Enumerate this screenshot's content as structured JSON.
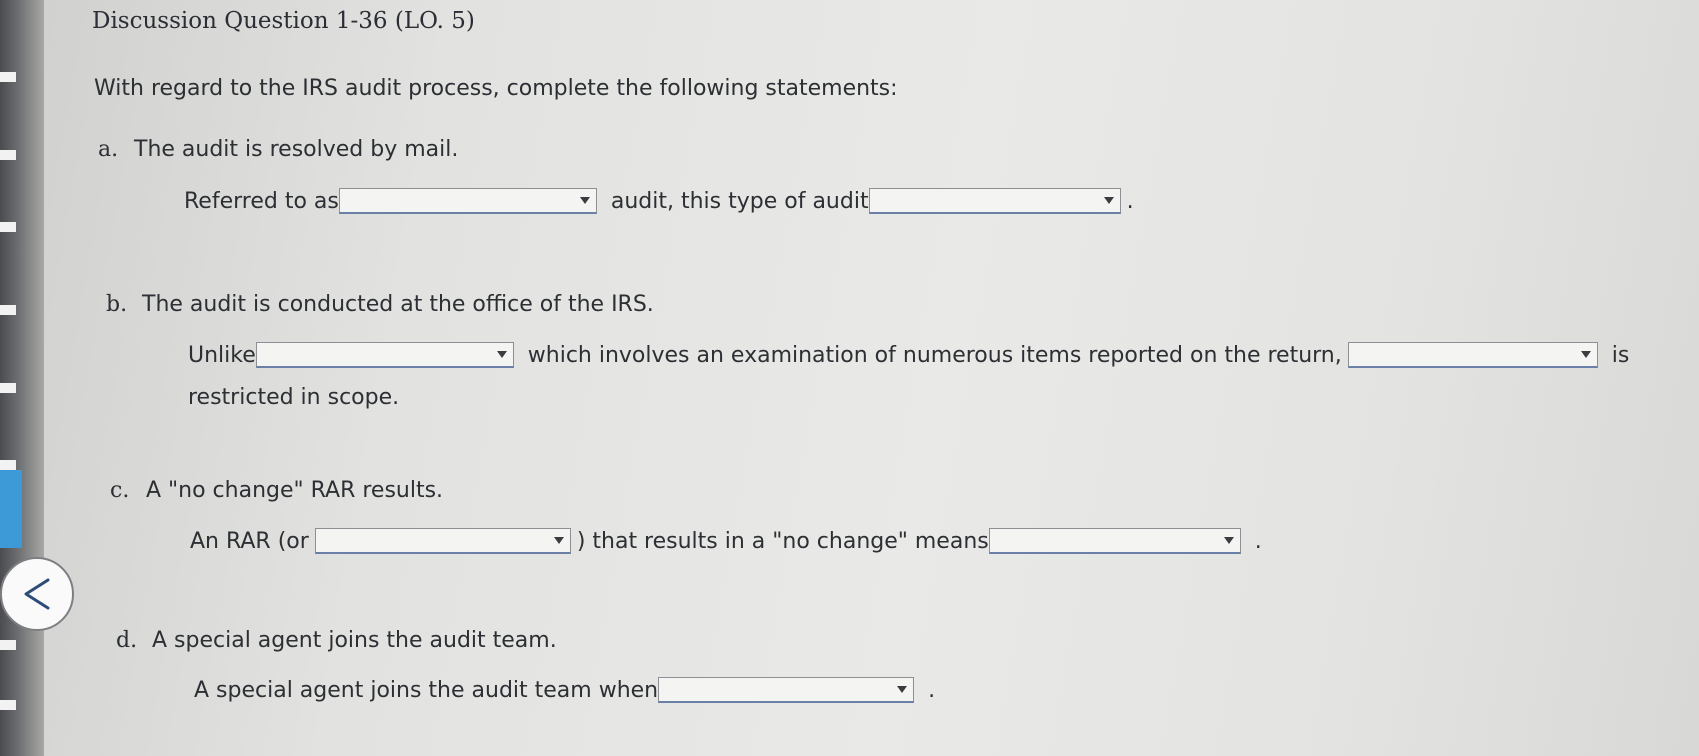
{
  "question": {
    "title": "Discussion Question 1-36 (LO. 5)",
    "instructions": "With regard to the IRS audit process, complete the following statements:"
  },
  "items": [
    {
      "letter": "a.",
      "statement": "The audit is resolved by mail.",
      "sentence": {
        "p1": "Referred to as",
        "p2": "audit, this type of audit",
        "p3": "."
      },
      "dropdowns": [
        "",
        ""
      ]
    },
    {
      "letter": "b.",
      "statement": "The audit is conducted at the office of the IRS.",
      "sentence": {
        "p1": "Unlike",
        "p2": "which involves an examination of numerous items reported on the return,",
        "p3": "is",
        "p4": "restricted in scope."
      },
      "dropdowns": [
        "",
        ""
      ]
    },
    {
      "letter": "c.",
      "statement": "A \"no change\" RAR results.",
      "sentence": {
        "p1": "An RAR (or",
        "p2": ") that results in a \"no change\" means",
        "p3": "."
      },
      "dropdowns": [
        "",
        ""
      ]
    },
    {
      "letter": "d.",
      "statement": "A special agent joins the audit team.",
      "sentence": {
        "p1": "A special agent joins the audit team when",
        "p2": "."
      },
      "dropdowns": [
        ""
      ]
    }
  ],
  "nav": {
    "back_icon": "chevron-left-icon"
  },
  "colors": {
    "accent_blue": "#3d9ad6",
    "dropdown_underline": "#6b80a6"
  }
}
